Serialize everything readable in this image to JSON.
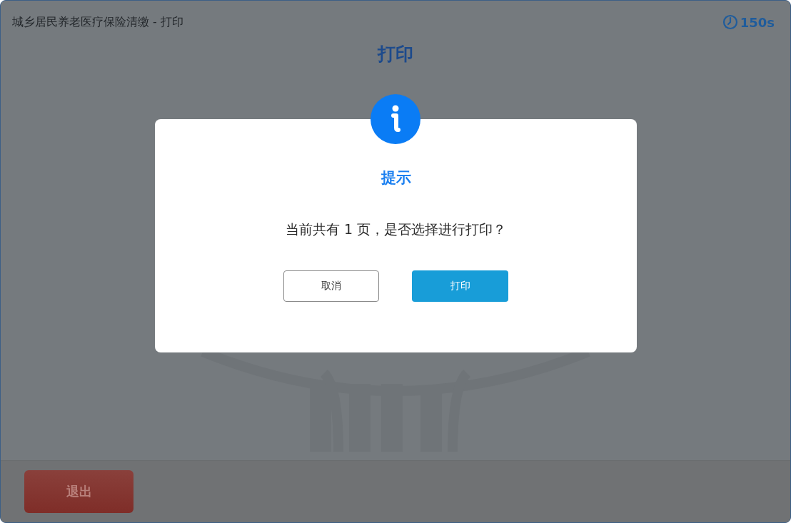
{
  "header": {
    "title": "城乡居民养老医疗保险清缴 - 打印",
    "timer": "150s"
  },
  "page_title": "打印",
  "dialog": {
    "title": "提示",
    "message": "当前共有 1 页，是否选择进行打印？",
    "buttons": [
      {
        "label": "取消",
        "kind": "secondary"
      },
      {
        "label": "打印",
        "kind": "primary"
      }
    ]
  },
  "footer": {
    "exit_button": "退出"
  }
}
